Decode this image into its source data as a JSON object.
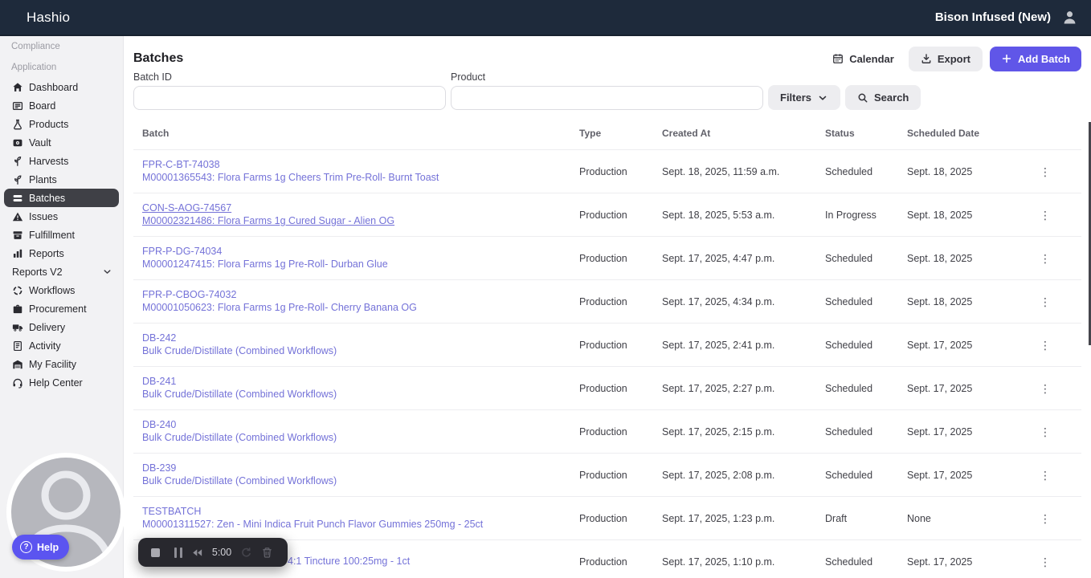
{
  "topbar": {
    "brand": "Hashio",
    "facility": "Bison Infused (New)"
  },
  "sidebar": {
    "sections": [
      {
        "label": "Compliance",
        "items": []
      },
      {
        "label": "Application",
        "items": [
          {
            "label": "Dashboard",
            "icon": "home"
          },
          {
            "label": "Board",
            "icon": "board"
          },
          {
            "label": "Products",
            "icon": "flask"
          },
          {
            "label": "Vault",
            "icon": "vault"
          },
          {
            "label": "Harvests",
            "icon": "harvest"
          },
          {
            "label": "Plants",
            "icon": "plant"
          },
          {
            "label": "Batches",
            "icon": "batches",
            "selected": true
          },
          {
            "label": "Issues",
            "icon": "warning"
          },
          {
            "label": "Fulfillment",
            "icon": "box"
          },
          {
            "label": "Reports",
            "icon": "bar-chart"
          },
          {
            "label": "Reports V2",
            "icon": "",
            "chevron": true
          },
          {
            "label": "Workflows",
            "icon": "sync"
          },
          {
            "label": "Procurement",
            "icon": "briefcase"
          },
          {
            "label": "Delivery",
            "icon": "truck"
          },
          {
            "label": "Activity",
            "icon": "activity"
          },
          {
            "label": "My Facility",
            "icon": "garage"
          },
          {
            "label": "Help Center",
            "icon": "headset"
          }
        ]
      }
    ]
  },
  "page": {
    "title": "Batches"
  },
  "actions": {
    "calendar": "Calendar",
    "export": "Export",
    "add_batch": "Add Batch"
  },
  "filters": {
    "batch_id_label": "Batch ID",
    "batch_id_value": "",
    "product_label": "Product",
    "product_value": "",
    "filters_button": "Filters",
    "search_button": "Search"
  },
  "table": {
    "columns": [
      "Batch",
      "Type",
      "Created At",
      "Status",
      "Scheduled Date"
    ],
    "rows": [
      {
        "id": "FPR-C-BT-74038",
        "product": "M00001365543: Flora Farms 1g Cheers Trim Pre-Roll- Burnt Toast",
        "type": "Production",
        "created": "Sept. 18, 2025, 11:59 a.m.",
        "status": "Scheduled",
        "scheduled": "Sept. 18, 2025"
      },
      {
        "id": "CON-S-AOG-74567",
        "product": "M00002321486: Flora Farms 1g Cured Sugar - Alien OG",
        "type": "Production",
        "created": "Sept. 18, 2025, 5:53 a.m.",
        "status": "In Progress",
        "scheduled": "Sept. 18, 2025",
        "underlined": true
      },
      {
        "id": "FPR-P-DG-74034",
        "product": "M00001247415: Flora Farms 1g Pre-Roll- Durban Glue",
        "type": "Production",
        "created": "Sept. 17, 2025, 4:47 p.m.",
        "status": "Scheduled",
        "scheduled": "Sept. 18, 2025"
      },
      {
        "id": "FPR-P-CBOG-74032",
        "product": "M00001050623: Flora Farms 1g Pre-Roll- Cherry Banana OG",
        "type": "Production",
        "created": "Sept. 17, 2025, 4:34 p.m.",
        "status": "Scheduled",
        "scheduled": "Sept. 18, 2025"
      },
      {
        "id": "DB-242",
        "product": "Bulk Crude/Distillate (Combined Workflows)",
        "type": "Production",
        "created": "Sept. 17, 2025, 2:41 p.m.",
        "status": "Scheduled",
        "scheduled": "Sept. 17, 2025"
      },
      {
        "id": "DB-241",
        "product": "Bulk Crude/Distillate (Combined Workflows)",
        "type": "Production",
        "created": "Sept. 17, 2025, 2:27 p.m.",
        "status": "Scheduled",
        "scheduled": "Sept. 17, 2025"
      },
      {
        "id": "DB-240",
        "product": "Bulk Crude/Distillate (Combined Workflows)",
        "type": "Production",
        "created": "Sept. 17, 2025, 2:15 p.m.",
        "status": "Scheduled",
        "scheduled": "Sept. 17, 2025"
      },
      {
        "id": "DB-239",
        "product": "Bulk Crude/Distillate (Combined Workflows)",
        "type": "Production",
        "created": "Sept. 17, 2025, 2:08 p.m.",
        "status": "Scheduled",
        "scheduled": "Sept. 17, 2025"
      },
      {
        "id": "TESTBATCH",
        "product": "M00001311527: Zen - Mini Indica Fruit Punch Flavor Gummies 250mg - 25ct",
        "type": "Production",
        "created": "Sept. 17, 2025, 1:23 p.m.",
        "status": "Draft",
        "scheduled": "None"
      },
      {
        "id": "",
        "product": "4:1 Tincture 100:25mg - 1ct",
        "type": "Production",
        "created": "Sept. 17, 2025, 1:10 p.m.",
        "status": "Scheduled",
        "scheduled": "Sept. 17, 2025",
        "partially_hidden": true
      }
    ]
  },
  "recorder": {
    "time": "5:00"
  },
  "help": {
    "label": "Help"
  },
  "colors": {
    "topbar": "#1e2a3b",
    "accent": "#6056e8",
    "link": "#7472d8",
    "selected_nav": "#3f4046"
  }
}
